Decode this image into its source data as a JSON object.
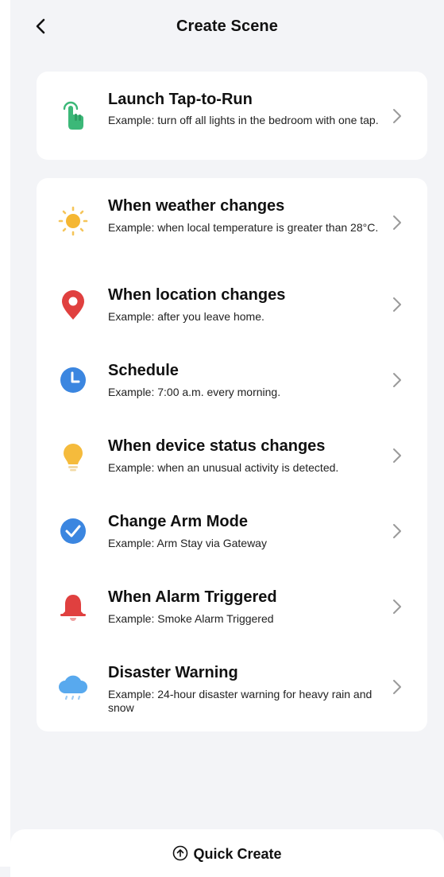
{
  "header": {
    "title": "Create Scene"
  },
  "tap_to_run": {
    "title": "Launch Tap-to-Run",
    "desc": "Example: turn off all lights in the bedroom with one tap."
  },
  "conditions": [
    {
      "title": "When weather changes",
      "desc": "Example: when local temperature is greater than 28°C."
    },
    {
      "title": "When location changes",
      "desc": "Example: after you leave home."
    },
    {
      "title": "Schedule",
      "desc": "Example: 7:00 a.m. every morning."
    },
    {
      "title": "When device status changes",
      "desc": "Example: when an unusual activity is detected."
    },
    {
      "title": "Change Arm Mode",
      "desc": "Example: Arm Stay via Gateway"
    },
    {
      "title": "When Alarm Triggered",
      "desc": "Example: Smoke Alarm Triggered"
    },
    {
      "title": "Disaster Warning",
      "desc": "Example: 24-hour disaster warning for heavy rain and snow"
    }
  ],
  "footer": {
    "quick_create": "Quick Create"
  },
  "icons": {
    "back": "chevron-left-icon",
    "tap": "tap-hand-icon",
    "weather": "sun-icon",
    "location": "location-pin-icon",
    "schedule": "clock-icon",
    "device": "light-bulb-icon",
    "arm": "checkmark-shield-icon",
    "alarm": "bell-icon",
    "disaster": "rain-cloud-icon",
    "quick_create": "upload-circle-icon"
  },
  "colors": {
    "background": "#f3f4f7",
    "card": "#ffffff",
    "green": "#3cb878",
    "sun": "#f5b733",
    "red": "#e0403f",
    "blue": "#3b86e0",
    "yellow": "#f5bb3c",
    "sky": "#58a9ee",
    "chevron": "#9a9a9a"
  }
}
